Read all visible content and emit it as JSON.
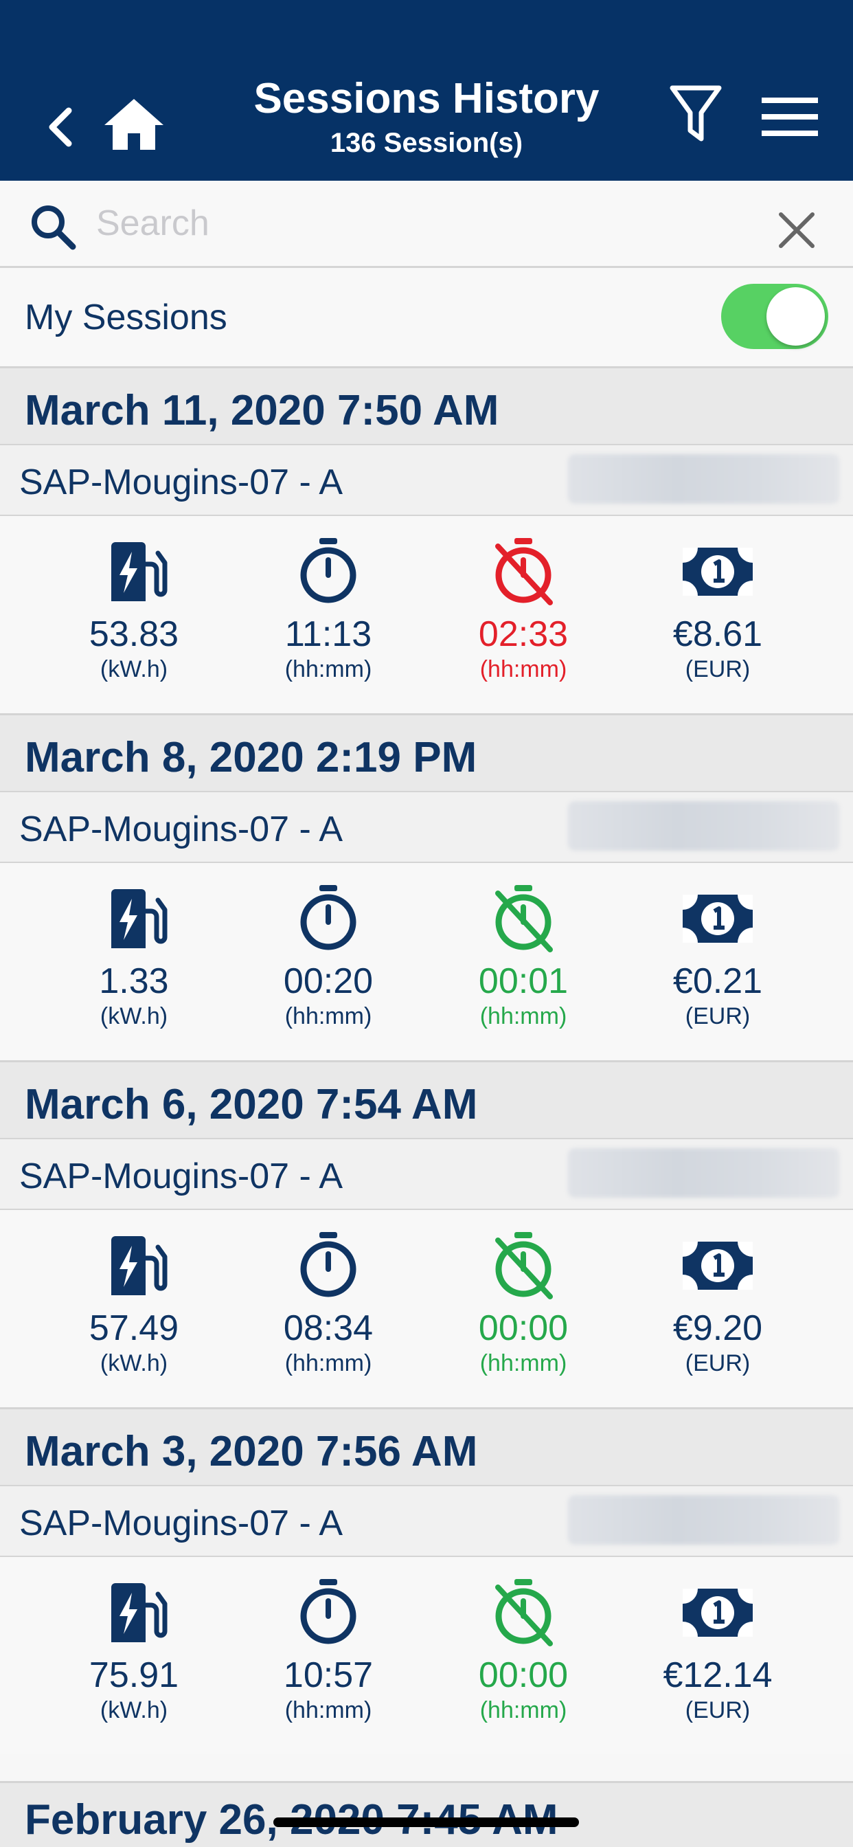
{
  "header": {
    "title": "Sessions History",
    "subtitle": "136 Session(s)",
    "back_icon": "chevron-left-icon",
    "home_icon": "home-icon",
    "filter_icon": "filter-icon",
    "menu_icon": "hamburger-menu-icon"
  },
  "search": {
    "placeholder": "Search",
    "value": ""
  },
  "my_sessions": {
    "label": "My Sessions",
    "toggle_on": true
  },
  "colors": {
    "header_bg": "#063266",
    "text": "#0f3463",
    "red": "#e3202a",
    "green": "#25a84b",
    "toggle": "#57d163"
  },
  "sessions": [
    {
      "date": "March 11, 2020 7:50 AM",
      "station": "SAP-Mougins-07 - A",
      "energy": "53.83",
      "energy_unit": "(kW.h)",
      "duration": "11:13",
      "duration_unit": "(hh:mm)",
      "inactivity": "02:33",
      "inactivity_unit": "(hh:mm)",
      "inactivity_status": "red",
      "price": "€8.61",
      "price_unit": "(EUR)"
    },
    {
      "date": "March 8, 2020 2:19 PM",
      "station": "SAP-Mougins-07 - A",
      "energy": "1.33",
      "energy_unit": "(kW.h)",
      "duration": "00:20",
      "duration_unit": "(hh:mm)",
      "inactivity": "00:01",
      "inactivity_unit": "(hh:mm)",
      "inactivity_status": "green",
      "price": "€0.21",
      "price_unit": "(EUR)"
    },
    {
      "date": "March 6, 2020 7:54 AM",
      "station": "SAP-Mougins-07 - A",
      "energy": "57.49",
      "energy_unit": "(kW.h)",
      "duration": "08:34",
      "duration_unit": "(hh:mm)",
      "inactivity": "00:00",
      "inactivity_unit": "(hh:mm)",
      "inactivity_status": "green",
      "price": "€9.20",
      "price_unit": "(EUR)"
    },
    {
      "date": "March 3, 2020 7:56 AM",
      "station": "SAP-Mougins-07 - A",
      "energy": "75.91",
      "energy_unit": "(kW.h)",
      "duration": "10:57",
      "duration_unit": "(hh:mm)",
      "inactivity": "00:00",
      "inactivity_unit": "(hh:mm)",
      "inactivity_status": "green",
      "price": "€12.14",
      "price_unit": "(EUR)"
    },
    {
      "date": "February 26, 2020 7:45 AM"
    }
  ]
}
